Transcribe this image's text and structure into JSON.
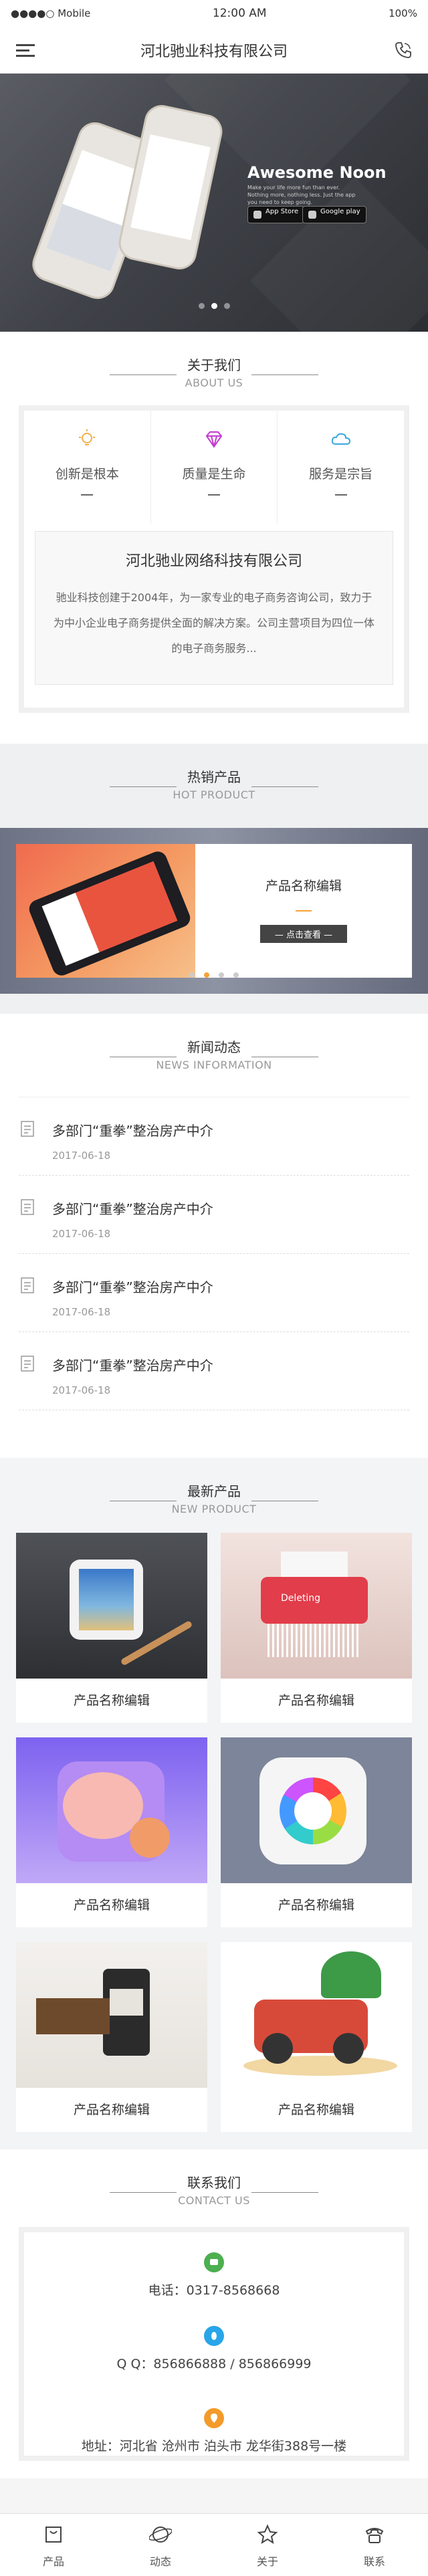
{
  "status": {
    "carrier": "●●●●○ Mobile",
    "time": "12:00 AM",
    "battery": "100%"
  },
  "header": {
    "title": "河北驰业科技有限公司"
  },
  "banner": {
    "title": "Awesome Noon",
    "subtitle": "Make your life more fun than ever. Nothing more, nothing less. Just the app you need to keep going.",
    "store1": "App Store",
    "store2": "Google play",
    "dots": 3,
    "active_dot": 1
  },
  "about": {
    "title": "关于我们",
    "subtitle": "ABOUT US",
    "features": [
      {
        "label": "创新是根本",
        "icon": "lightbulb-icon",
        "color": "#f3b04a"
      },
      {
        "label": "质量是生命",
        "icon": "diamond-icon",
        "color": "#c43ad2"
      },
      {
        "label": "服务是宗旨",
        "icon": "cloud-icon",
        "color": "#3aa8e0"
      }
    ],
    "company": "河北驰业网络科技有限公司",
    "desc": "驰业科技创建于2004年，为一家专业的电子商务咨询公司，致力于为中小企业电子商务提供全面的解决方案。公司主营项目为四位一体的电子商务服务..."
  },
  "hot": {
    "title": "热销产品",
    "subtitle": "HOT PRODUCT",
    "product_name": "产品名称编辑",
    "button": "— 点击查看 —",
    "dots": 4,
    "active_dot": 1
  },
  "news": {
    "title": "新闻动态",
    "subtitle": "NEWS INFORMATION",
    "items": [
      {
        "title": "多部门“重拳”整治房产中介",
        "date": "2017-06-18"
      },
      {
        "title": "多部门“重拳”整治房产中介",
        "date": "2017-06-18"
      },
      {
        "title": "多部门“重拳”整治房产中介",
        "date": "2017-06-18"
      },
      {
        "title": "多部门“重拳”整治房产中介",
        "date": "2017-06-18"
      }
    ]
  },
  "new_products": {
    "title": "最新产品",
    "subtitle": "NEW PRODUCT",
    "items": [
      {
        "name": "产品名称编辑"
      },
      {
        "name": "产品名称编辑",
        "img_text": "Deleting"
      },
      {
        "name": "产品名称编辑"
      },
      {
        "name": "产品名称编辑"
      },
      {
        "name": "产品名称编辑"
      },
      {
        "name": "产品名称编辑"
      }
    ]
  },
  "contact": {
    "title": "联系我们",
    "subtitle": "CONTACT US",
    "phone": "电话：0317-8568668",
    "qq": "Q Q：856866888 / 856866999",
    "address": "地址：河北省 沧州市 泊头市 龙华街388号一楼",
    "colors": {
      "phone": "#4caf50",
      "qq": "#2aa5e8",
      "address": "#f39a2b"
    }
  },
  "tabbar": {
    "items": [
      "产品",
      "动态",
      "关于",
      "联系"
    ]
  }
}
